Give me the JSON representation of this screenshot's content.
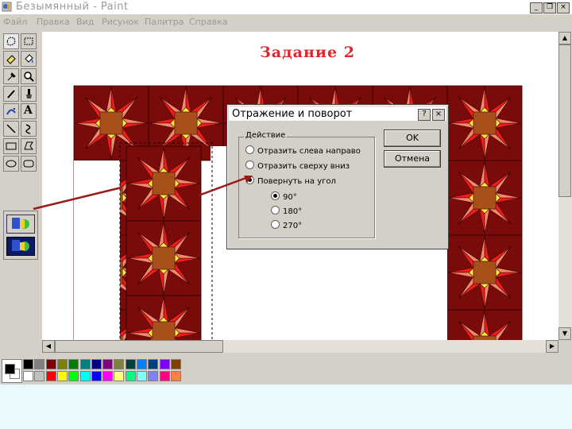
{
  "window": {
    "title": "Безымянный - Paint",
    "controls": {
      "minimize": "_",
      "maximize": "❐",
      "close": "×"
    }
  },
  "menu": {
    "items": [
      "Файл",
      "Правка",
      "Вид",
      "Рисунок",
      "Палитра",
      "Справка"
    ]
  },
  "toolbox": {
    "tools": [
      "free-select",
      "rect-select",
      "eraser",
      "fill",
      "eyedropper",
      "magnifier",
      "pencil",
      "brush",
      "airbrush",
      "text",
      "line",
      "curve",
      "rectangle",
      "polygon",
      "ellipse",
      "rounded-rectangle"
    ],
    "text_tool_label": "A"
  },
  "canvas": {
    "heading": "Задание 2"
  },
  "dialog": {
    "title": "Отражение и поворот",
    "help": "?",
    "close": "×",
    "group_label": "Действие",
    "options": [
      {
        "label": "Отразить слева направо",
        "selected": false
      },
      {
        "label": "Отразить сверху вниз",
        "selected": false
      },
      {
        "label": "Повернуть на угол",
        "selected": true
      }
    ],
    "angles": [
      {
        "label": "90°",
        "selected": true
      },
      {
        "label": "180°",
        "selected": false
      },
      {
        "label": "270°",
        "selected": false
      }
    ],
    "ok_label": "OK",
    "cancel_label": "Отмена"
  },
  "palette": {
    "foreground": "#000000",
    "background": "#ffffff",
    "colors_top": [
      "#000000",
      "#808080",
      "#800000",
      "#808000",
      "#008000",
      "#008080",
      "#000080",
      "#800080",
      "#808040",
      "#004040",
      "#0080ff",
      "#004080",
      "#8000ff",
      "#804000"
    ],
    "colors_bottom": [
      "#ffffff",
      "#c0c0c0",
      "#ff0000",
      "#ffff00",
      "#00ff00",
      "#00ffff",
      "#0000ff",
      "#ff00ff",
      "#ffff80",
      "#00ff80",
      "#80ffff",
      "#8080ff",
      "#ff0080",
      "#ff8040"
    ]
  },
  "tile_colors": {
    "border": "#7a0b0b",
    "red": "#ee1c1c",
    "salmon": "#f0886a",
    "yellow": "#fbec3a",
    "brown": "#a8501a"
  }
}
